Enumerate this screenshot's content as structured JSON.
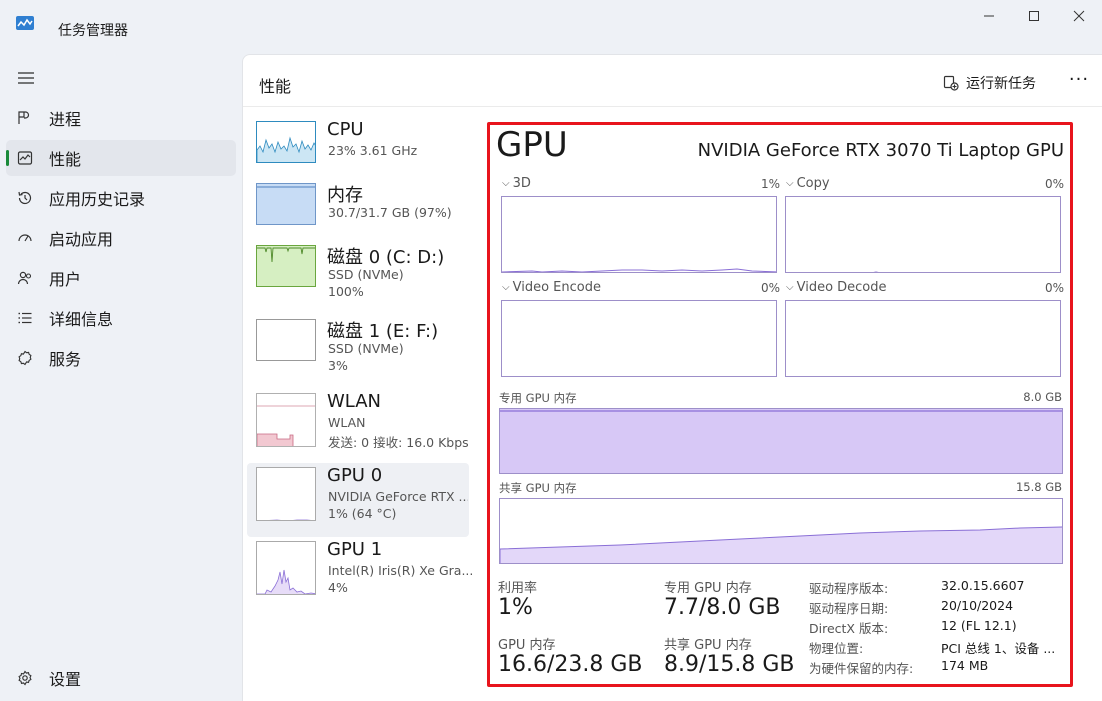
{
  "window": {
    "title": "任务管理器"
  },
  "sidebar": {
    "items": [
      {
        "label": "进程",
        "icon": "processes-icon"
      },
      {
        "label": "性能",
        "icon": "performance-icon",
        "active": true
      },
      {
        "label": "应用历史记录",
        "icon": "app-history-icon"
      },
      {
        "label": "启动应用",
        "icon": "startup-apps-icon"
      },
      {
        "label": "用户",
        "icon": "users-icon"
      },
      {
        "label": "详细信息",
        "icon": "details-icon"
      },
      {
        "label": "服务",
        "icon": "services-icon"
      }
    ],
    "settings_label": "设置"
  },
  "header": {
    "title": "性能",
    "run_task": "运行新任务",
    "more": "···"
  },
  "resources": [
    {
      "name": "CPU",
      "sub1": "23% 3.61 GHz",
      "sub2": ""
    },
    {
      "name": "内存",
      "sub1": "30.7/31.7 GB (97%)",
      "sub2": ""
    },
    {
      "name": "磁盘 0 (C: D:)",
      "sub1": "SSD (NVMe)",
      "sub2": "100%"
    },
    {
      "name": "磁盘 1 (E: F:)",
      "sub1": "SSD (NVMe)",
      "sub2": "3%"
    },
    {
      "name": "WLAN",
      "sub1": "WLAN",
      "sub2": "发送: 0 接收: 16.0 Kbps"
    },
    {
      "name": "GPU 0",
      "sub1": "NVIDIA GeForce RTX ...",
      "sub2": "1% (64 °C)"
    },
    {
      "name": "GPU 1",
      "sub1": "Intel(R) Iris(R) Xe Gra...",
      "sub2": "4%"
    }
  ],
  "gpu": {
    "title": "GPU",
    "model": "NVIDIA GeForce RTX 3070 Ti Laptop GPU",
    "engines": [
      {
        "label": "3D",
        "value": "1%"
      },
      {
        "label": "Copy",
        "value": "0%"
      },
      {
        "label": "Video Encode",
        "value": "0%"
      },
      {
        "label": "Video Decode",
        "value": "0%"
      }
    ],
    "dedicated_mem": {
      "label": "专用 GPU 内存",
      "max": "8.0 GB",
      "level": 1.0
    },
    "shared_mem": {
      "label": "共享 GPU 内存",
      "max": "15.8 GB"
    },
    "stats": {
      "utilization_label": "利用率",
      "utilization": "1%",
      "gpu_mem_label": "GPU 内存",
      "gpu_mem": "16.6/23.8 GB",
      "dedicated_label": "专用 GPU 内存",
      "dedicated": "7.7/8.0 GB",
      "shared_label": "共享 GPU 内存",
      "shared": "8.9/15.8 GB"
    },
    "info": [
      {
        "k": "驱动程序版本:",
        "v": "32.0.15.6607"
      },
      {
        "k": "驱动程序日期:",
        "v": "20/10/2024"
      },
      {
        "k": "DirectX 版本:",
        "v": "12 (FL 12.1)"
      },
      {
        "k": "物理位置:",
        "v": "PCI 总线 1、设备 ..."
      },
      {
        "k": "为硬件保留的内存:",
        "v": "174 MB"
      }
    ]
  }
}
